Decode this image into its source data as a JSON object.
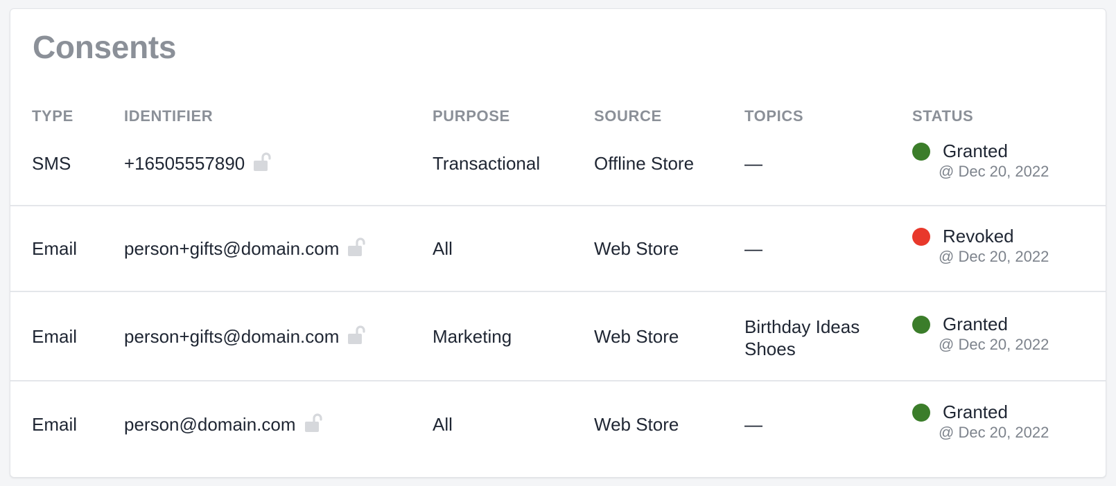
{
  "page": {
    "title": "Consents"
  },
  "table": {
    "headers": {
      "type": "TYPE",
      "identifier": "IDENTIFIER",
      "purpose": "PURPOSE",
      "source": "SOURCE",
      "topics": "TOPICS",
      "status": "STATUS"
    },
    "rows": [
      {
        "type": "SMS",
        "identifier": "+16505557890",
        "identifier_icon": "unlocked-padlock-icon",
        "purpose": "Transactional",
        "source": "Offline Store",
        "topics": [
          "—"
        ],
        "status": "Granted",
        "status_date": "@ Dec 20, 2022",
        "status_color": "#3b7d2a"
      },
      {
        "type": "Email",
        "identifier": "person+gifts@domain.com",
        "identifier_icon": "unlocked-padlock-icon",
        "purpose": "All",
        "source": "Web Store",
        "topics": [
          "—"
        ],
        "status": "Revoked",
        "status_date": "@ Dec 20, 2022",
        "status_color": "#e8382b"
      },
      {
        "type": "Email",
        "identifier": "person+gifts@domain.com",
        "identifier_icon": "unlocked-padlock-icon",
        "purpose": "Marketing",
        "source": "Web Store",
        "topics": [
          "Birthday Ideas",
          "Shoes"
        ],
        "status": "Granted",
        "status_date": "@ Dec 20, 2022",
        "status_color": "#3b7d2a"
      },
      {
        "type": "Email",
        "identifier": "person@domain.com",
        "identifier_icon": "unlocked-padlock-icon",
        "purpose": "All",
        "source": "Web Store",
        "topics": [
          "—"
        ],
        "status": "Granted",
        "status_date": "@ Dec 20, 2022",
        "status_color": "#3b7d2a"
      }
    ]
  },
  "colors": {
    "granted": "#3b7d2a",
    "revoked": "#e8382b",
    "lock_icon": "#d6d8dc",
    "header_text": "#8b9098",
    "body_text": "#1f2633"
  }
}
